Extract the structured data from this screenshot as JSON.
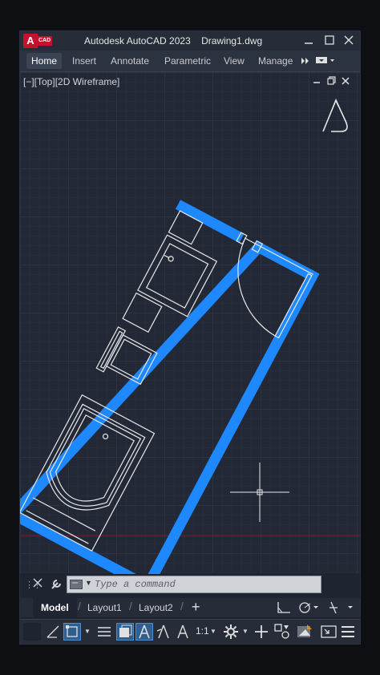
{
  "titlebar": {
    "app_badge": "A",
    "app_badge_sub": "CAD",
    "title": "Autodesk AutoCAD 2023    Drawing1.dwg",
    "icons": [
      "minimize-icon",
      "maximize-icon",
      "close-icon"
    ]
  },
  "ribbon": {
    "tabs": [
      {
        "label": "Home",
        "active": true
      },
      {
        "label": "Insert"
      },
      {
        "label": "Parametric"
      },
      {
        "label": "Annotate"
      },
      {
        "label": "View"
      },
      {
        "label": "Manage"
      }
    ],
    "overflow_icon": "double-chevron-right-icon"
  },
  "viewport": {
    "label": "[−][Top][2D Wireframe]",
    "accent_color": "#1e88ff"
  },
  "command": {
    "placeholder": "Type a command"
  },
  "layout_tabs": {
    "tabs": [
      {
        "label": "Model",
        "active": true
      },
      {
        "label": "Layout1"
      },
      {
        "label": "Layout2"
      }
    ],
    "add_label": "+"
  },
  "statusbar": {
    "scale": "1:1"
  }
}
